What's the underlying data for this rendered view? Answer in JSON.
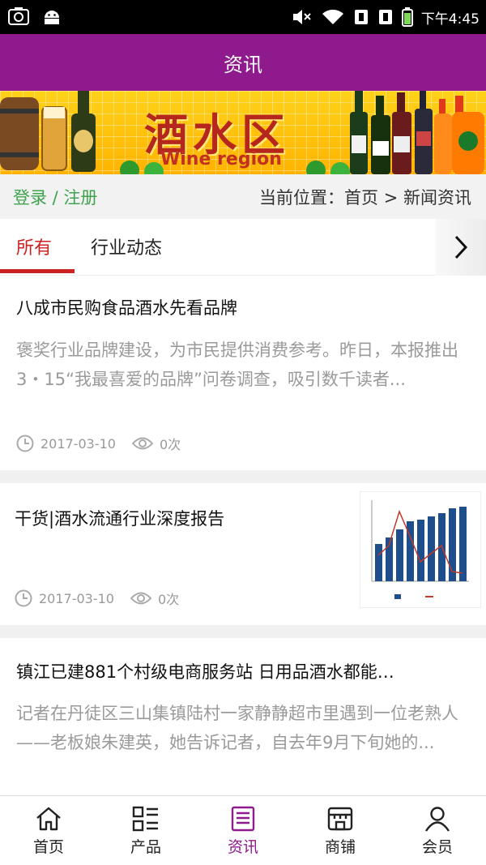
{
  "statusbar": {
    "time": "下午4:45"
  },
  "title": "资讯",
  "banner": {
    "title_cn": "酒水区",
    "title_en": "Wine region"
  },
  "breadcrumb": {
    "login": "登录 / 注册",
    "path": "当前位置：首页 > 新闻资讯"
  },
  "tabs": [
    {
      "label": "所有",
      "active": true
    },
    {
      "label": "行业动态",
      "active": false
    }
  ],
  "articles": [
    {
      "title": "八成市民购食品酒水先看品牌",
      "desc": "褒奖行业品牌建设，为市民提供消费参考。昨日，本报推出3・15“我最喜爱的品牌”问卷调查，吸引数千读者...",
      "date": "2017-03-10",
      "views": "0次"
    },
    {
      "title": "干货|酒水流通行业深度报告",
      "date": "2017-03-10",
      "views": "0次"
    },
    {
      "title": "镇江已建881个村级电商服务站 日用品酒水都能…",
      "desc": "记者在丹徒区三山集镇陆村一家静静超市里遇到一位老熟人——老板娘朱建英，她告诉记者，自去年9月下旬她的..."
    }
  ],
  "nav": [
    {
      "label": "首页",
      "icon": "home-icon"
    },
    {
      "label": "产品",
      "icon": "grid-list-icon"
    },
    {
      "label": "资讯",
      "icon": "news-icon",
      "active": true
    },
    {
      "label": "商铺",
      "icon": "shop-icon"
    },
    {
      "label": "会员",
      "icon": "user-icon"
    }
  ],
  "colors": {
    "brand": "#8e1a8e",
    "accent_red": "#cc2222",
    "link_green": "#3fa34d"
  }
}
